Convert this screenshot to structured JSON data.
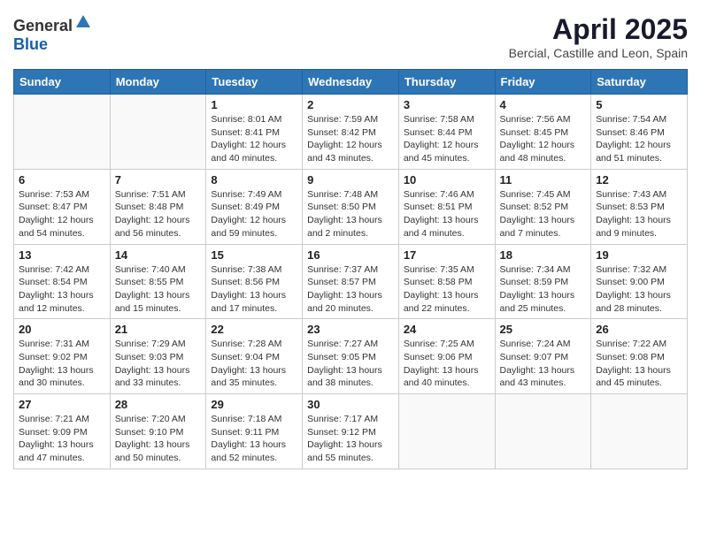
{
  "header": {
    "logo_general": "General",
    "logo_blue": "Blue",
    "month_title": "April 2025",
    "location": "Bercial, Castille and Leon, Spain"
  },
  "weekdays": [
    "Sunday",
    "Monday",
    "Tuesday",
    "Wednesday",
    "Thursday",
    "Friday",
    "Saturday"
  ],
  "weeks": [
    [
      {
        "day": "",
        "info": ""
      },
      {
        "day": "",
        "info": ""
      },
      {
        "day": "1",
        "info": "Sunrise: 8:01 AM\nSunset: 8:41 PM\nDaylight: 12 hours and 40 minutes."
      },
      {
        "day": "2",
        "info": "Sunrise: 7:59 AM\nSunset: 8:42 PM\nDaylight: 12 hours and 43 minutes."
      },
      {
        "day": "3",
        "info": "Sunrise: 7:58 AM\nSunset: 8:44 PM\nDaylight: 12 hours and 45 minutes."
      },
      {
        "day": "4",
        "info": "Sunrise: 7:56 AM\nSunset: 8:45 PM\nDaylight: 12 hours and 48 minutes."
      },
      {
        "day": "5",
        "info": "Sunrise: 7:54 AM\nSunset: 8:46 PM\nDaylight: 12 hours and 51 minutes."
      }
    ],
    [
      {
        "day": "6",
        "info": "Sunrise: 7:53 AM\nSunset: 8:47 PM\nDaylight: 12 hours and 54 minutes."
      },
      {
        "day": "7",
        "info": "Sunrise: 7:51 AM\nSunset: 8:48 PM\nDaylight: 12 hours and 56 minutes."
      },
      {
        "day": "8",
        "info": "Sunrise: 7:49 AM\nSunset: 8:49 PM\nDaylight: 12 hours and 59 minutes."
      },
      {
        "day": "9",
        "info": "Sunrise: 7:48 AM\nSunset: 8:50 PM\nDaylight: 13 hours and 2 minutes."
      },
      {
        "day": "10",
        "info": "Sunrise: 7:46 AM\nSunset: 8:51 PM\nDaylight: 13 hours and 4 minutes."
      },
      {
        "day": "11",
        "info": "Sunrise: 7:45 AM\nSunset: 8:52 PM\nDaylight: 13 hours and 7 minutes."
      },
      {
        "day": "12",
        "info": "Sunrise: 7:43 AM\nSunset: 8:53 PM\nDaylight: 13 hours and 9 minutes."
      }
    ],
    [
      {
        "day": "13",
        "info": "Sunrise: 7:42 AM\nSunset: 8:54 PM\nDaylight: 13 hours and 12 minutes."
      },
      {
        "day": "14",
        "info": "Sunrise: 7:40 AM\nSunset: 8:55 PM\nDaylight: 13 hours and 15 minutes."
      },
      {
        "day": "15",
        "info": "Sunrise: 7:38 AM\nSunset: 8:56 PM\nDaylight: 13 hours and 17 minutes."
      },
      {
        "day": "16",
        "info": "Sunrise: 7:37 AM\nSunset: 8:57 PM\nDaylight: 13 hours and 20 minutes."
      },
      {
        "day": "17",
        "info": "Sunrise: 7:35 AM\nSunset: 8:58 PM\nDaylight: 13 hours and 22 minutes."
      },
      {
        "day": "18",
        "info": "Sunrise: 7:34 AM\nSunset: 8:59 PM\nDaylight: 13 hours and 25 minutes."
      },
      {
        "day": "19",
        "info": "Sunrise: 7:32 AM\nSunset: 9:00 PM\nDaylight: 13 hours and 28 minutes."
      }
    ],
    [
      {
        "day": "20",
        "info": "Sunrise: 7:31 AM\nSunset: 9:02 PM\nDaylight: 13 hours and 30 minutes."
      },
      {
        "day": "21",
        "info": "Sunrise: 7:29 AM\nSunset: 9:03 PM\nDaylight: 13 hours and 33 minutes."
      },
      {
        "day": "22",
        "info": "Sunrise: 7:28 AM\nSunset: 9:04 PM\nDaylight: 13 hours and 35 minutes."
      },
      {
        "day": "23",
        "info": "Sunrise: 7:27 AM\nSunset: 9:05 PM\nDaylight: 13 hours and 38 minutes."
      },
      {
        "day": "24",
        "info": "Sunrise: 7:25 AM\nSunset: 9:06 PM\nDaylight: 13 hours and 40 minutes."
      },
      {
        "day": "25",
        "info": "Sunrise: 7:24 AM\nSunset: 9:07 PM\nDaylight: 13 hours and 43 minutes."
      },
      {
        "day": "26",
        "info": "Sunrise: 7:22 AM\nSunset: 9:08 PM\nDaylight: 13 hours and 45 minutes."
      }
    ],
    [
      {
        "day": "27",
        "info": "Sunrise: 7:21 AM\nSunset: 9:09 PM\nDaylight: 13 hours and 47 minutes."
      },
      {
        "day": "28",
        "info": "Sunrise: 7:20 AM\nSunset: 9:10 PM\nDaylight: 13 hours and 50 minutes."
      },
      {
        "day": "29",
        "info": "Sunrise: 7:18 AM\nSunset: 9:11 PM\nDaylight: 13 hours and 52 minutes."
      },
      {
        "day": "30",
        "info": "Sunrise: 7:17 AM\nSunset: 9:12 PM\nDaylight: 13 hours and 55 minutes."
      },
      {
        "day": "",
        "info": ""
      },
      {
        "day": "",
        "info": ""
      },
      {
        "day": "",
        "info": ""
      }
    ]
  ]
}
